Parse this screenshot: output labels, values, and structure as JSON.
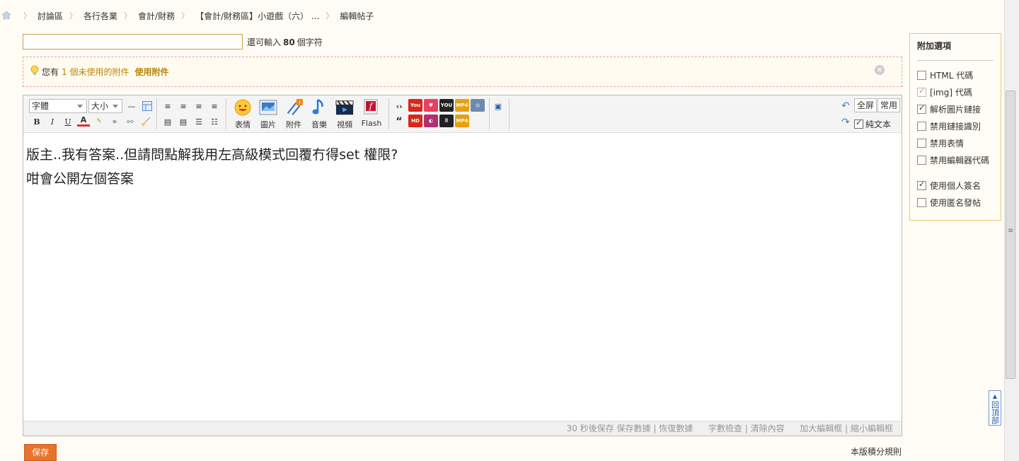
{
  "breadcrumb": {
    "items": [
      "討論區",
      "各行各業",
      "會計/財務",
      "【會計/財務區】小遊戲（六） ...",
      "編輯帖子"
    ]
  },
  "subject": {
    "value": "",
    "hint_prefix": "還可輸入",
    "hint_count": "80",
    "hint_suffix": "個字符"
  },
  "attachment_notice": {
    "prefix": "您有",
    "count_text": "1 個未使用的附件",
    "use_label": "使用附件"
  },
  "toolbar": {
    "font_select": "字體",
    "size_select": "大小",
    "bold": "B",
    "italic": "I",
    "underline": "U",
    "big_buttons": [
      "表情",
      "圖片",
      "附件",
      "音樂",
      "視頻",
      "Flash"
    ],
    "fullscreen": "全屏",
    "common": "常用",
    "plain_text": "純文本"
  },
  "content": {
    "lines": [
      "版主..我有答案..但請問點解我用左高級模式回覆冇得set 權限?",
      "咁會公開左個答案"
    ]
  },
  "statusbar": {
    "autosave": "30 秒後保存",
    "save_data": "保存數據",
    "restore_data": "恢復數據",
    "word_check": "字數檢查",
    "clear_content": "清除內容",
    "enlarge": "加大編輯框",
    "shrink": "縮小編輯框",
    "sep": "|"
  },
  "actions": {
    "save": "保存",
    "rules": "本版積分規則"
  },
  "options": {
    "title": "附加選項",
    "items": [
      {
        "label": "HTML 代碼",
        "checked": false
      },
      {
        "label": "[img] 代碼",
        "checked": true,
        "disabled": true
      },
      {
        "label": "解析圖片鏈接",
        "checked": true
      },
      {
        "label": "禁用鏈接識別",
        "checked": false
      },
      {
        "label": "禁用表情",
        "checked": false
      },
      {
        "label": "禁用編輯器代碼",
        "checked": false
      },
      {
        "label": "使用個人簽名",
        "checked": true
      },
      {
        "label": "使用匿名發帖",
        "checked": false
      }
    ]
  },
  "back_to_top": "回頂部",
  "colors": {
    "accent": "#e8742c",
    "link": "#b8860b",
    "option_border": "#f0c674"
  }
}
